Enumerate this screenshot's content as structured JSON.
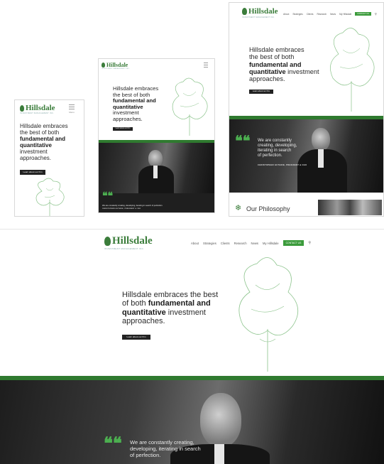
{
  "brand": {
    "name": "Hillsdale",
    "tagline": "INVESTMENT MANAGEMENT INC."
  },
  "hero": {
    "line1": "Hillsdale embraces",
    "line2": "the best of both",
    "bold1": "fundamental and",
    "bold2": "quantitative",
    "rest1": "investment",
    "rest2": "approaches.",
    "desktop_line1": "Hillsdale embraces the best",
    "desktop_line2": "of both",
    "desktop_bold1": "fundamental and",
    "desktop_bold2": "quantitative",
    "desktop_rest": "investment",
    "desktop_end": "approaches.",
    "cta": "Learn about our firm"
  },
  "mobile": {
    "menu_label": "Menu"
  },
  "nav": {
    "items": [
      "About",
      "Strategies",
      "Clients",
      "Research",
      "News",
      "My Hillsdale"
    ],
    "contact": "CONTACT US",
    "search_icon": "search-icon"
  },
  "quote": {
    "text_tablet": "We are constantly creating, developing, iterating in search of perfection.",
    "text_line1": "We are constantly",
    "text_line2": "creating, developing,",
    "text_line3": "iterating in search",
    "text_line4": "of perfection.",
    "desktop_line1": "We are constantly creating,",
    "desktop_line2": "developing, iterating in search",
    "desktop_line3": "of perfection.",
    "author": "CHRISTOPHER GUTHRIE, PRESIDENT & CEO",
    "author_tablet": "CHRISTOPHER GUTHRIE, PRESIDENT & CEO"
  },
  "philosophy": {
    "title": "Our Philosophy"
  },
  "colors": {
    "brand_green": "#3b7d3b",
    "accent_green": "#4caf50",
    "dark": "#222222"
  }
}
